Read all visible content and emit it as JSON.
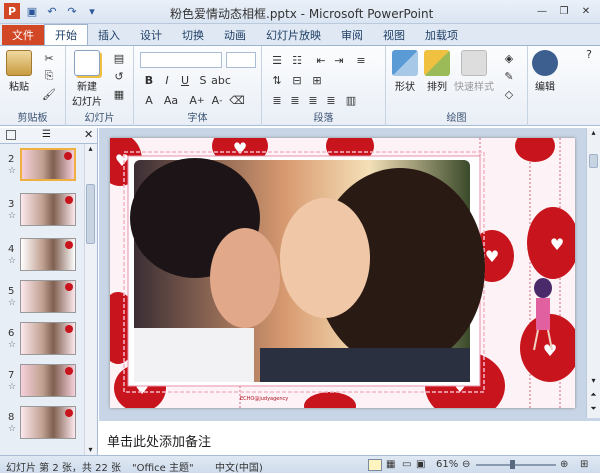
{
  "window": {
    "title": "粉色爱情动态相框.pptx - Microsoft PowerPoint"
  },
  "tabs": [
    "文件",
    "开始",
    "插入",
    "设计",
    "切换",
    "动画",
    "幻灯片放映",
    "审阅",
    "视图",
    "加载项"
  ],
  "ribbon": {
    "clipboard": {
      "paste": "粘贴",
      "label": "剪贴板"
    },
    "slides": {
      "new_slide": "新建\n幻灯片",
      "label": "幻灯片"
    },
    "font": {
      "label": "字体"
    },
    "paragraph": {
      "label": "段落"
    },
    "drawing": {
      "shapes": "形状",
      "arrange": "排列",
      "quick_styles": "快速样式",
      "label": "绘图"
    },
    "editing": {
      "edit": "编辑"
    }
  },
  "thumbnails": [
    {
      "num": "2",
      "selected": true
    },
    {
      "num": "3"
    },
    {
      "num": "4"
    },
    {
      "num": "5"
    },
    {
      "num": "6"
    },
    {
      "num": "7"
    },
    {
      "num": "8"
    }
  ],
  "slide": {
    "watermark": "ECHO@judyagency"
  },
  "notes": {
    "placeholder": "单击此处添加备注"
  },
  "status": {
    "slide_info": "幻灯片 第 2 张，共 22 张",
    "theme": "\"Office 主题\"",
    "language": "中文(中国)",
    "zoom": "61%"
  },
  "colors": {
    "accent": "#d24726",
    "balloon": "#c8141c",
    "frame_pink": "#f4b6c6"
  }
}
